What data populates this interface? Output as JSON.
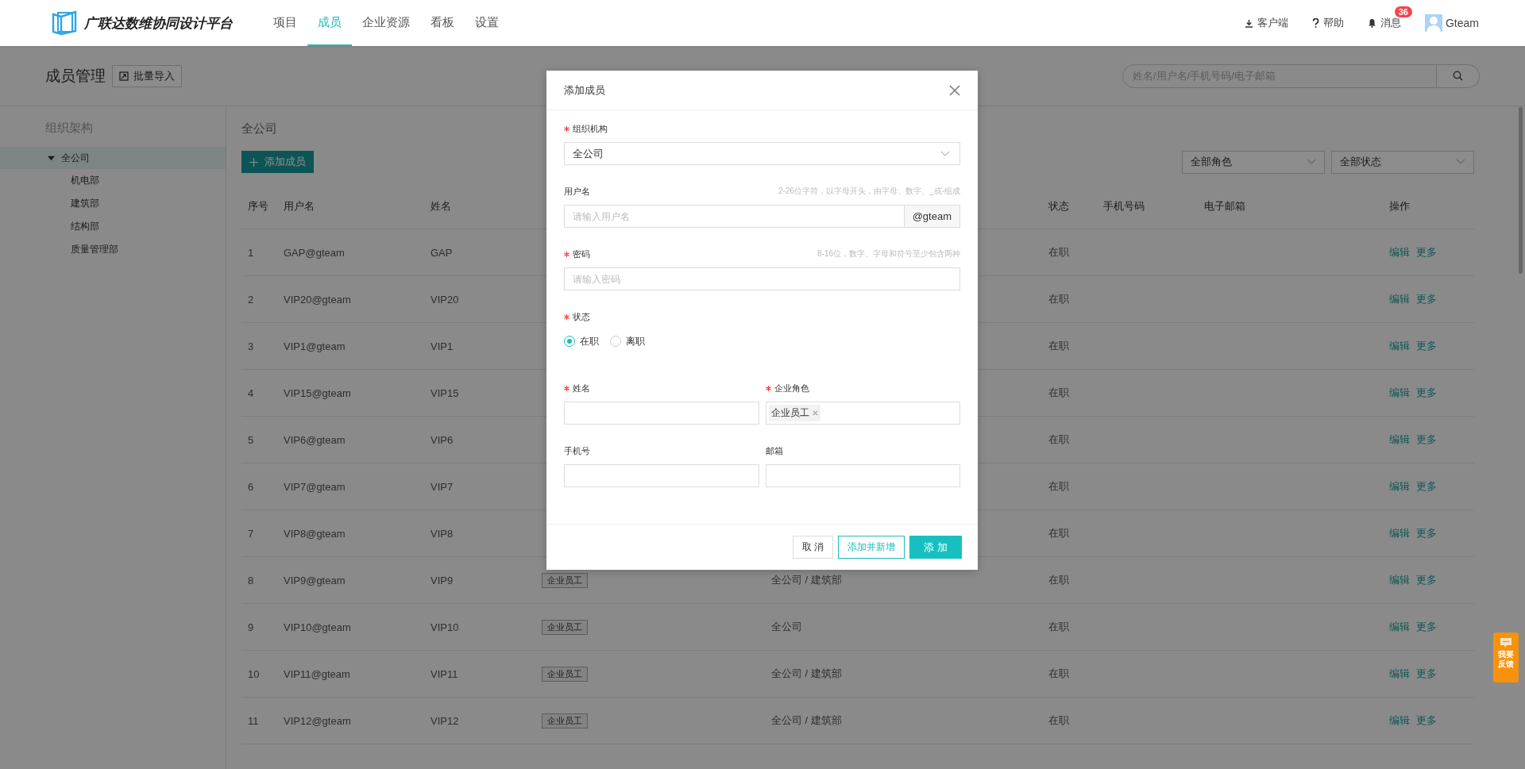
{
  "header": {
    "brand": "广联达数维协同设计平台",
    "nav": [
      {
        "label": "项目",
        "selected": false
      },
      {
        "label": "成员",
        "selected": true
      },
      {
        "label": "企业资源",
        "selected": false
      },
      {
        "label": "看板",
        "selected": false
      },
      {
        "label": "设置",
        "selected": false
      }
    ],
    "actions": [
      {
        "kind": "download",
        "label": "客户端"
      },
      {
        "kind": "help",
        "label": "帮助"
      },
      {
        "kind": "bell",
        "label": "消息",
        "badge": "36"
      }
    ],
    "user": {
      "name": "Gteam"
    }
  },
  "page": {
    "title": "成员管理",
    "import_button": "批量导入",
    "search": {
      "placeholder": "姓名/用户名/手机号码/电子邮箱"
    }
  },
  "sidebar": {
    "title": "组织架构",
    "tree": [
      {
        "label": "全公司",
        "selected": true,
        "expanded": true,
        "children": [
          {
            "label": "机电部",
            "selected": false
          },
          {
            "label": "建筑部",
            "selected": false
          },
          {
            "label": "结构部",
            "selected": false
          },
          {
            "label": "质量管理部",
            "selected": false
          }
        ]
      }
    ]
  },
  "content": {
    "title": "全公司",
    "add_button": "添加成员",
    "filters": [
      "全部角色",
      "全部状态"
    ],
    "table": {
      "header": {
        "index": "序号",
        "username": "用户名",
        "name": "姓名",
        "status": "状态",
        "phone": "手机号码",
        "email": "电子邮箱",
        "actions": "操作"
      },
      "rows": [
        {
          "index": "1",
          "username": "GAP@gteam",
          "name": "GAP",
          "status": "在职",
          "actions": [
            "编辑",
            "更多"
          ]
        },
        {
          "index": "2",
          "username": "VIP20@gteam",
          "name": "VIP20",
          "status": "在职",
          "actions": [
            "编辑",
            "更多"
          ]
        },
        {
          "index": "3",
          "username": "VIP1@gteam",
          "name": "VIP1",
          "status": "在职",
          "actions": [
            "编辑",
            "更多"
          ]
        },
        {
          "index": "4",
          "username": "VIP15@gteam",
          "name": "VIP15",
          "status": "在职",
          "actions": [
            "编辑",
            "更多"
          ]
        },
        {
          "index": "5",
          "username": "VIP6@gteam",
          "name": "VIP6",
          "status": "在职",
          "actions": [
            "编辑",
            "更多"
          ]
        },
        {
          "index": "6",
          "username": "VIP7@gteam",
          "name": "VIP7",
          "status": "在职",
          "actions": [
            "编辑",
            "更多"
          ]
        },
        {
          "index": "7",
          "username": "VIP8@gteam",
          "name": "VIP8",
          "status": "在职",
          "actions": [
            "编辑",
            "更多"
          ]
        },
        {
          "index": "8",
          "username": "VIP9@gteam",
          "name": "VIP9",
          "role": "企业员工",
          "org": "全公司 / 建筑部",
          "status": "在职",
          "actions": [
            "编辑",
            "更多"
          ]
        },
        {
          "index": "9",
          "username": "VIP10@gteam",
          "name": "VIP10",
          "role": "企业员工",
          "org": "全公司",
          "status": "在职",
          "actions": [
            "编辑",
            "更多"
          ]
        },
        {
          "index": "10",
          "username": "VIP11@gteam",
          "name": "VIP11",
          "role": "企业员工",
          "org": "全公司 / 建筑部",
          "status": "在职",
          "actions": [
            "编辑",
            "更多"
          ]
        },
        {
          "index": "11",
          "username": "VIP12@gteam",
          "name": "VIP12",
          "role": "企业员工",
          "org": "全公司 / 建筑部",
          "status": "在职",
          "actions": [
            "编辑",
            "更多"
          ]
        }
      ]
    }
  },
  "dialog": {
    "title": "添加成员",
    "fields": [
      {
        "kind": "select",
        "label": "组织机构",
        "required": true,
        "value": "全公司"
      },
      {
        "kind": "text",
        "label": "用户名",
        "hint": "2-26位字符，以字母开头，由字母、数字、_或-组成",
        "placeholder": "请输入用户名",
        "suffix": "@gteam"
      },
      {
        "kind": "text",
        "label": "密码",
        "required": true,
        "hint": "8-16位，数字、字母和符号至少包含两种",
        "placeholder": "请输入密码"
      },
      {
        "kind": "radio",
        "label": "状态",
        "required": true,
        "options": [
          {
            "label": "在职",
            "selected": true
          },
          {
            "label": "离职",
            "selected": false
          }
        ]
      },
      {
        "kind": "row",
        "items": [
          {
            "kind": "text",
            "label": "姓名",
            "required": true
          },
          {
            "kind": "tags",
            "label": "企业角色",
            "required": true,
            "tags": [
              "企业员工"
            ]
          }
        ]
      },
      {
        "kind": "row",
        "items": [
          {
            "kind": "text",
            "label": "手机号"
          },
          {
            "kind": "text",
            "label": "邮箱"
          }
        ]
      }
    ],
    "buttons": [
      {
        "kind": "default",
        "label": "取 消"
      },
      {
        "kind": "outline",
        "label": "添加并新增"
      },
      {
        "kind": "primary",
        "label": "添 加"
      }
    ]
  },
  "feedback": {
    "label": "我要反馈"
  }
}
